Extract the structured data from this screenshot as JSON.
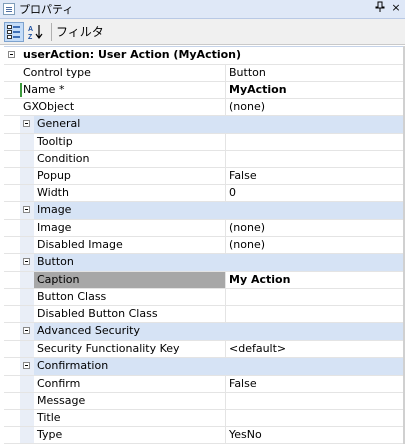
{
  "titlebar": {
    "title": "プロパティ",
    "pin_glyph": "ᵖ",
    "close_glyph": "×"
  },
  "toolbar": {
    "filter_label": "フィルタ",
    "sort_glyph": "A↓Z"
  },
  "grid": {
    "root_title": "userAction: User Action (MyAction)",
    "top_rows": [
      {
        "name": "Control type",
        "value": "Button",
        "bold": false
      },
      {
        "name": "Name *",
        "value": "MyAction",
        "bold": true
      },
      {
        "name": "GXObject",
        "value": "(none)",
        "bold": false
      }
    ],
    "categories": [
      {
        "title": "General",
        "rows": [
          {
            "name": "Tooltip",
            "value": ""
          },
          {
            "name": "Condition",
            "value": ""
          },
          {
            "name": "Popup",
            "value": "False"
          },
          {
            "name": "Width",
            "value": "0"
          }
        ]
      },
      {
        "title": "Image",
        "rows": [
          {
            "name": "Image",
            "value": "(none)"
          },
          {
            "name": "Disabled Image",
            "value": "(none)"
          }
        ]
      },
      {
        "title": "Button",
        "rows": [
          {
            "name": "Caption",
            "value": "My Action"
          },
          {
            "name": "Button Class",
            "value": ""
          },
          {
            "name": "Disabled Button Class",
            "value": ""
          }
        ]
      },
      {
        "title": "Advanced Security",
        "rows": [
          {
            "name": "Security Functionality Key",
            "value": "<default>"
          }
        ]
      },
      {
        "title": "Confirmation",
        "rows": [
          {
            "name": "Confirm",
            "value": "False"
          },
          {
            "name": "Message",
            "value": ""
          },
          {
            "name": "Title",
            "value": ""
          },
          {
            "name": "Type",
            "value": "YesNo"
          }
        ]
      }
    ]
  }
}
